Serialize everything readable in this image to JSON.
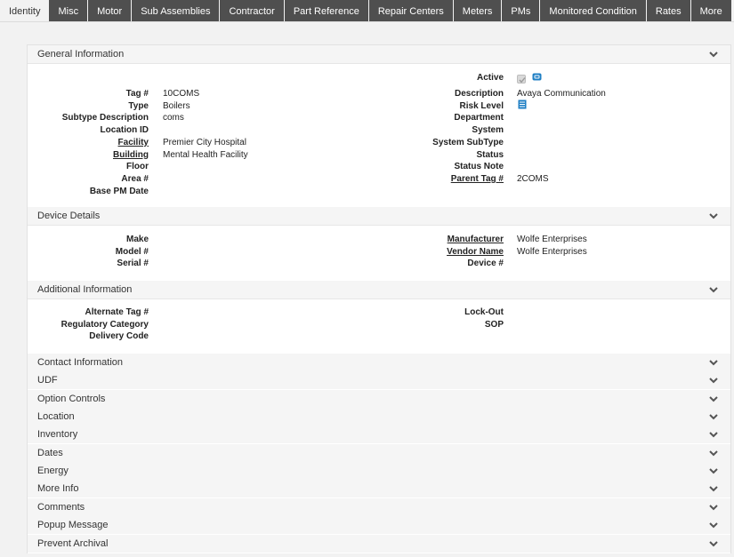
{
  "tabs": [
    {
      "label": "Identity",
      "active": true
    },
    {
      "label": "Misc"
    },
    {
      "label": "Motor"
    },
    {
      "label": "Sub Assemblies"
    },
    {
      "label": "Contractor"
    },
    {
      "label": "Part Reference"
    },
    {
      "label": "Repair Centers"
    },
    {
      "label": "Meters"
    },
    {
      "label": "PMs"
    },
    {
      "label": "Monitored Condition"
    },
    {
      "label": "Rates"
    },
    {
      "label": "More"
    }
  ],
  "general": {
    "title": "General Information",
    "active_label": "Active",
    "active_checked": true,
    "left": [
      {
        "label": "Tag #",
        "value": "10COMS"
      },
      {
        "label": "Type",
        "value": "Boilers"
      },
      {
        "label": "Subtype Description",
        "value": "coms"
      },
      {
        "label": "Location ID",
        "value": ""
      },
      {
        "label": "Facility",
        "value": "Premier City Hospital",
        "link": true
      },
      {
        "label": "Building",
        "value": "Mental Health Facility",
        "link": true
      },
      {
        "label": "Floor",
        "value": ""
      },
      {
        "label": "Area #",
        "value": ""
      },
      {
        "label": "Base PM Date",
        "value": ""
      }
    ],
    "right": [
      {
        "label": "Description",
        "value": "Avaya Communication"
      },
      {
        "label": "Risk Level",
        "value": ""
      },
      {
        "label": "Department",
        "value": ""
      },
      {
        "label": "System",
        "value": ""
      },
      {
        "label": "System SubType",
        "value": ""
      },
      {
        "label": "Status",
        "value": ""
      },
      {
        "label": "Status Note",
        "value": ""
      },
      {
        "label": "Parent Tag #",
        "value": "2COMS",
        "link": true
      }
    ]
  },
  "device": {
    "title": "Device Details",
    "left": [
      {
        "label": "Make",
        "value": ""
      },
      {
        "label": "Model #",
        "value": ""
      },
      {
        "label": "Serial #",
        "value": ""
      }
    ],
    "right": [
      {
        "label": "Manufacturer",
        "value": "Wolfe Enterprises",
        "link": true
      },
      {
        "label": "Vendor Name",
        "value": "Wolfe Enterprises",
        "link": true
      },
      {
        "label": "Device #",
        "value": ""
      }
    ]
  },
  "additional": {
    "title": "Additional Information",
    "left": [
      {
        "label": "Alternate Tag #",
        "value": ""
      },
      {
        "label": "Regulatory Category",
        "value": ""
      },
      {
        "label": "Delivery Code",
        "value": ""
      }
    ],
    "right": [
      {
        "label": "Lock-Out",
        "value": ""
      },
      {
        "label": "SOP",
        "value": ""
      }
    ]
  },
  "collapsed_sections": [
    "Contact Information",
    "UDF",
    "Option Controls",
    "Location",
    "Inventory",
    "Dates",
    "Energy",
    "More Info",
    "Comments",
    "Popup Message",
    "Prevent Archival"
  ],
  "icons": {
    "chevron": "chevron-down-icon",
    "info": "info-icon",
    "risk": "list-icon"
  },
  "colors": {
    "tab_bg": "#4f4f4f",
    "accent_blue": "#1f7fc4"
  }
}
